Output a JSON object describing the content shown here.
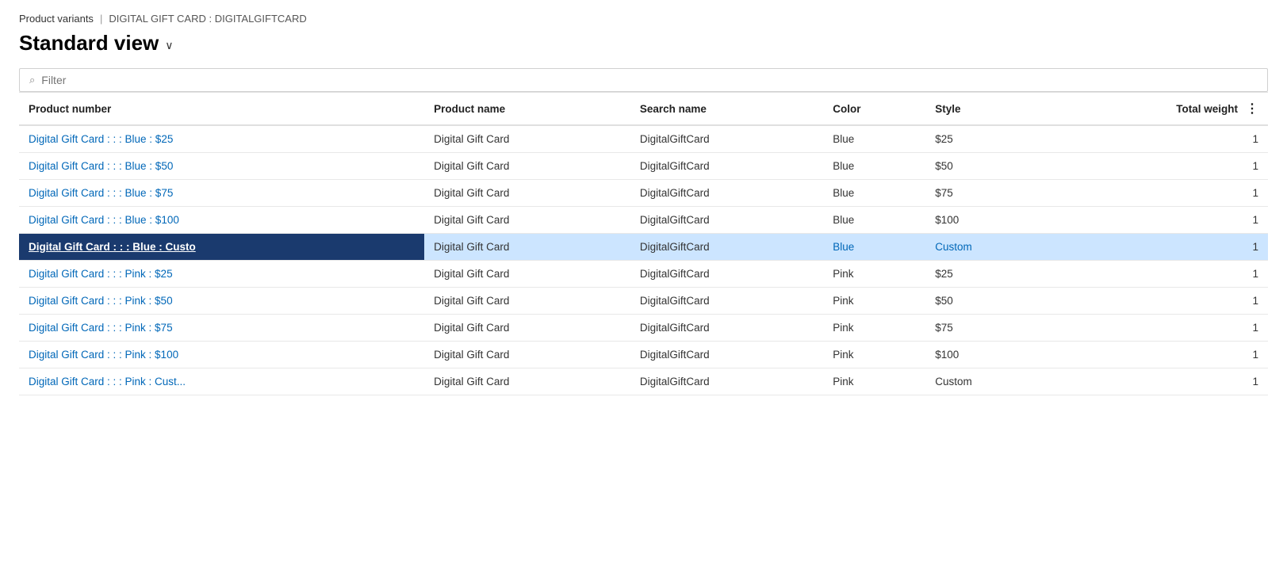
{
  "breadcrumb": {
    "link_label": "Product variants",
    "separator": "|",
    "current": "DIGITAL GIFT CARD : DIGITALGIFTCARD"
  },
  "page_title": "Standard view",
  "title_chevron": "∨",
  "filter": {
    "placeholder": "Filter",
    "icon": "🔍"
  },
  "columns": [
    {
      "id": "product_number",
      "label": "Product number"
    },
    {
      "id": "product_name",
      "label": "Product name"
    },
    {
      "id": "search_name",
      "label": "Search name"
    },
    {
      "id": "color",
      "label": "Color"
    },
    {
      "id": "style",
      "label": "Style"
    },
    {
      "id": "total_weight",
      "label": "Total weight"
    }
  ],
  "rows": [
    {
      "product_number": "Digital Gift Card : : : Blue : $25",
      "product_name": "Digital Gift Card",
      "search_name": "DigitalGiftCard",
      "color": "Blue",
      "style": "$25",
      "total_weight": "1",
      "selected": false
    },
    {
      "product_number": "Digital Gift Card : : : Blue : $50",
      "product_name": "Digital Gift Card",
      "search_name": "DigitalGiftCard",
      "color": "Blue",
      "style": "$50",
      "total_weight": "1",
      "selected": false
    },
    {
      "product_number": "Digital Gift Card : : : Blue : $75",
      "product_name": "Digital Gift Card",
      "search_name": "DigitalGiftCard",
      "color": "Blue",
      "style": "$75",
      "total_weight": "1",
      "selected": false
    },
    {
      "product_number": "Digital Gift Card : : : Blue : $100",
      "product_name": "Digital Gift Card",
      "search_name": "DigitalGiftCard",
      "color": "Blue",
      "style": "$100",
      "total_weight": "1",
      "selected": false
    },
    {
      "product_number": "Digital Gift Card : : : Blue : Custo",
      "product_number_full": "Digital Gift Card : : : Blue : Custom",
      "product_name": "Digital Gift Card",
      "search_name": "DigitalGiftCard",
      "color": "Blue",
      "style": "Custom",
      "total_weight": "1",
      "selected": true
    },
    {
      "product_number": "Digital Gift Card : : : Pink : $25",
      "product_name": "Digital Gift Card",
      "search_name": "DigitalGiftCard",
      "color": "Pink",
      "style": "$25",
      "total_weight": "1",
      "selected": false
    },
    {
      "product_number": "Digital Gift Card : : : Pink : $50",
      "product_name": "Digital Gift Card",
      "search_name": "DigitalGiftCard",
      "color": "Pink",
      "style": "$50",
      "total_weight": "1",
      "selected": false
    },
    {
      "product_number": "Digital Gift Card : : : Pink : $75",
      "product_name": "Digital Gift Card",
      "search_name": "DigitalGiftCard",
      "color": "Pink",
      "style": "$75",
      "total_weight": "1",
      "selected": false
    },
    {
      "product_number": "Digital Gift Card : : : Pink : $100",
      "product_name": "Digital Gift Card",
      "search_name": "DigitalGiftCard",
      "color": "Pink",
      "style": "$100",
      "total_weight": "1",
      "selected": false
    },
    {
      "product_number": "Digital Gift Card : : : Pink : Cust...",
      "product_name": "Digital Gift Card",
      "search_name": "DigitalGiftCard",
      "color": "Pink",
      "style": "Custom",
      "total_weight": "1",
      "selected": false
    }
  ]
}
